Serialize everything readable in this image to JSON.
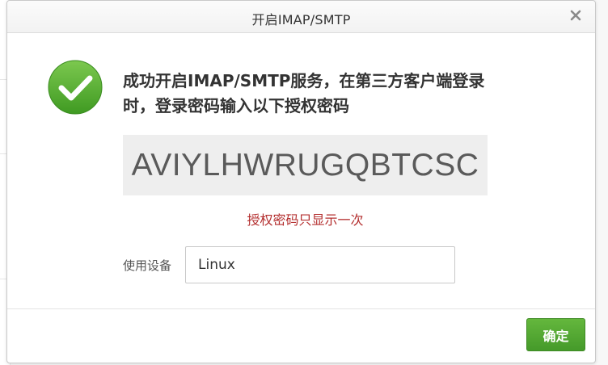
{
  "dialog": {
    "title": "开启IMAP/SMTP",
    "close_icon": "close-icon",
    "success_icon": "check-circle-icon",
    "message": "成功开启IMAP/SMTP服务，在第三方客户端登录时，登录密码输入以下授权密码",
    "auth_code": "AVIYLHWRUGQBTCSC",
    "warning": "授权密码只显示一次",
    "device_label": "使用设备",
    "device_value": "Linux",
    "confirm_label": "确定"
  },
  "colors": {
    "accent_green": "#4aa52e",
    "warning_red": "#b32d2d",
    "code_bg": "#eeeeee"
  }
}
